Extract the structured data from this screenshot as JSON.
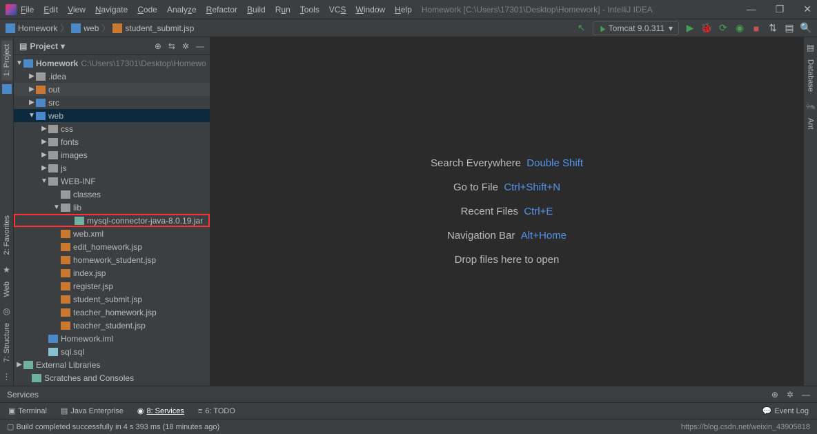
{
  "menu": [
    "File",
    "Edit",
    "View",
    "Navigate",
    "Code",
    "Analyze",
    "Refactor",
    "Build",
    "Run",
    "Tools",
    "VCS",
    "Window",
    "Help"
  ],
  "window_title": "Homework [C:\\Users\\17301\\Desktop\\Homework] - IntelliJ IDEA",
  "breadcrumbs": {
    "root": "Homework",
    "folder": "web",
    "file": "student_submit.jsp"
  },
  "run_config": "Tomcat 9.0.311",
  "panel": {
    "title": "Project"
  },
  "tree": {
    "root": "Homework",
    "root_path": "C:\\Users\\17301\\Desktop\\Homewo",
    "idea": ".idea",
    "out": "out",
    "src": "src",
    "web": "web",
    "css": "css",
    "fonts": "fonts",
    "images": "images",
    "js": "js",
    "webinf": "WEB-INF",
    "classes": "classes",
    "lib": "lib",
    "jar": "mysql-connector-java-8.0.19.jar",
    "webxml": "web.xml",
    "f1": "edit_homework.jsp",
    "f2": "homework_student.jsp",
    "f3": "index.jsp",
    "f4": "register.jsp",
    "f5": "student_submit.jsp",
    "f6": "teacher_homework.jsp",
    "f7": "teacher_student.jsp",
    "iml": "Homework.iml",
    "sql": "sql.sql",
    "ext": "External Libraries",
    "scratch": "Scratches and Consoles"
  },
  "editor": {
    "search": "Search Everywhere",
    "search_kbd": "Double Shift",
    "goto": "Go to File",
    "goto_kbd": "Ctrl+Shift+N",
    "recent": "Recent Files",
    "recent_kbd": "Ctrl+E",
    "nav": "Navigation Bar",
    "nav_kbd": "Alt+Home",
    "drop": "Drop files here to open"
  },
  "left_tabs": {
    "project": "1: Project",
    "fav": "2: Favorites",
    "web": "Web",
    "struct": "7: Structure"
  },
  "right_tabs": {
    "db": "Database",
    "ant": "Ant"
  },
  "bottom": {
    "terminal": "Terminal",
    "java": "Java Enterprise",
    "services": "8: Services",
    "todo": "6: TODO",
    "eventlog": "Event Log"
  },
  "services_label": "Services",
  "status": "Build completed successfully in 4 s 393 ms (18 minutes ago)",
  "url": "https://blog.csdn.net/weixin_43905818"
}
